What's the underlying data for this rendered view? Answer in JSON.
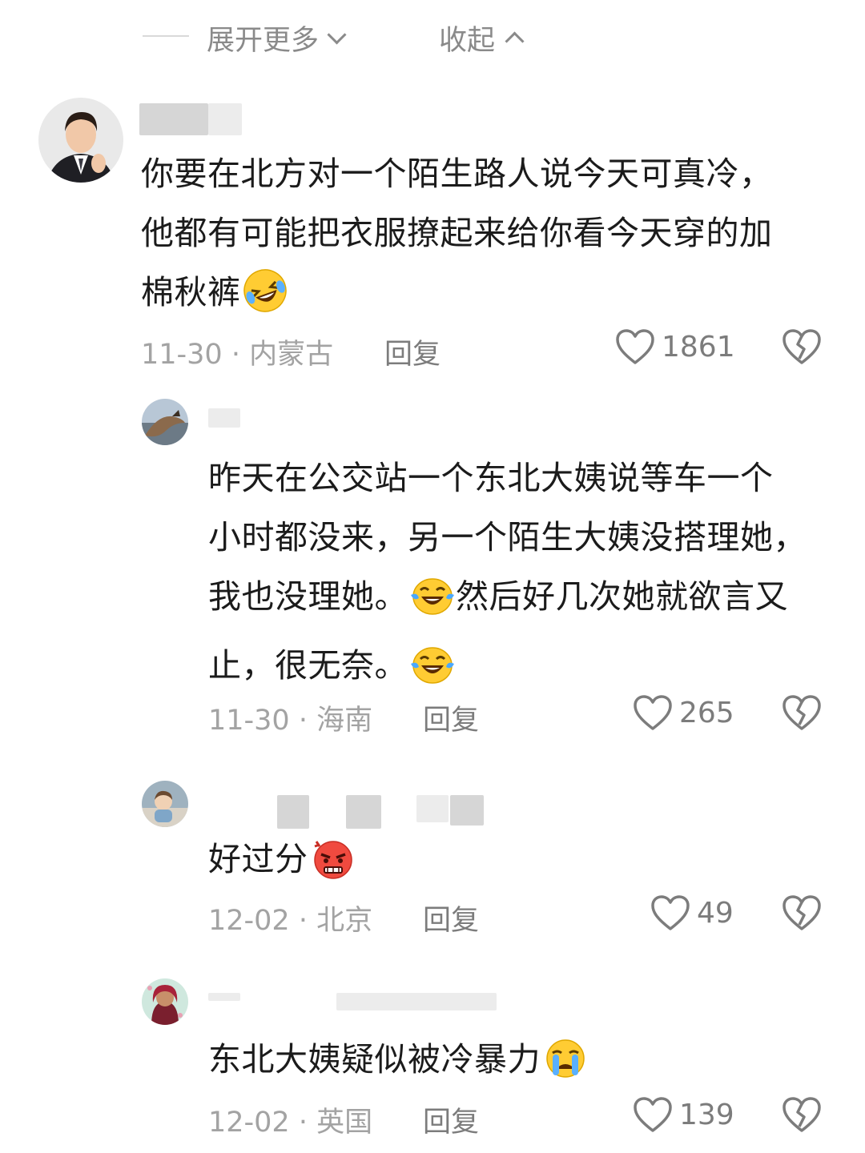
{
  "thread": {
    "expand_more": "展开更多",
    "collapse": "收起"
  },
  "comments": [
    {
      "text_lines": [
        "你要在北方对一个陌生路人说今天可真冷，",
        "他都有可能把衣服撩起来给你看今天穿的加",
        "棉秋裤"
      ],
      "emoji": "grinning-squint-tears-emoji",
      "date": "11-30",
      "location": "内蒙古",
      "reply": "回复",
      "likes": "1861"
    },
    {
      "text_lines": [
        "昨天在公交站一个东北大姨说等车一个",
        "小时都没来，另一个陌生大姨没搭理她，",
        "我也没理她。",
        "然后好几次她就欲言又",
        "止，很无奈。"
      ],
      "emoji": "laughing-tears-emoji",
      "date": "11-30",
      "location": "海南",
      "reply": "回复",
      "likes": "265"
    },
    {
      "text_lines": [
        "好过分"
      ],
      "emoji": "angry-face-emoji",
      "date": "12-02",
      "location": "北京",
      "reply": "回复",
      "likes": "49"
    },
    {
      "text_lines": [
        "东北大姨疑似被冷暴力"
      ],
      "emoji": "crying-face-emoji",
      "date": "12-02",
      "location": "英国",
      "reply": "回复",
      "likes": "139"
    }
  ],
  "meta_separator": "·",
  "colors": {
    "secondary_text": "#a3a3a3",
    "icon": "#7c7c7c"
  }
}
